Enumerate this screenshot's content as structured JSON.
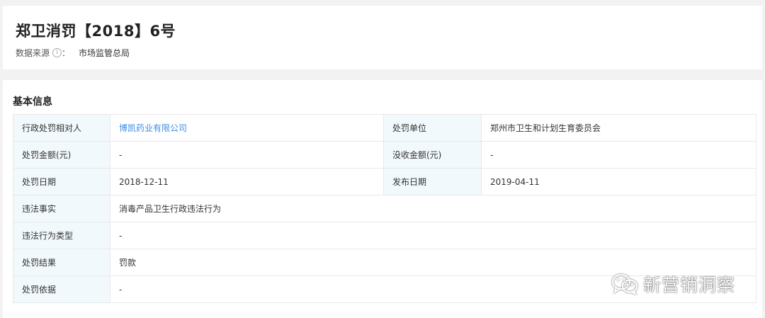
{
  "header": {
    "title": "郑卫消罚【2018】6号",
    "source_label": "数据来源",
    "source_info_icon": "info-circle-icon",
    "source_sep": "：",
    "source_value": "市场监管总局"
  },
  "basic_info": {
    "section_title": "基本信息",
    "rows": [
      {
        "l1": "行政处罚相对人",
        "v1": "博凯药业有限公司",
        "l2": "处罚单位",
        "v2": "郑州市卫生和计划生育委员会"
      },
      {
        "l1": "处罚金额(元)",
        "v1": "-",
        "l2": "没收金额(元)",
        "v2": "-"
      },
      {
        "l1": "处罚日期",
        "v1": "2018-12-11",
        "l2": "发布日期",
        "v2": "2019-04-11"
      },
      {
        "l1": "违法事实",
        "v1": "消毒产品卫生行政违法行为"
      },
      {
        "l1": "违法行为类型",
        "v1": "-"
      },
      {
        "l1": "处罚结果",
        "v1": "罚款"
      },
      {
        "l1": "处罚依据",
        "v1": "-"
      }
    ]
  },
  "watermark": {
    "icon": "wechat-icon",
    "text": "新营销洞察"
  },
  "colors": {
    "link": "#3a8ee6",
    "label_bg": "#f2f9fc",
    "page_bg": "#f2f2f2"
  }
}
